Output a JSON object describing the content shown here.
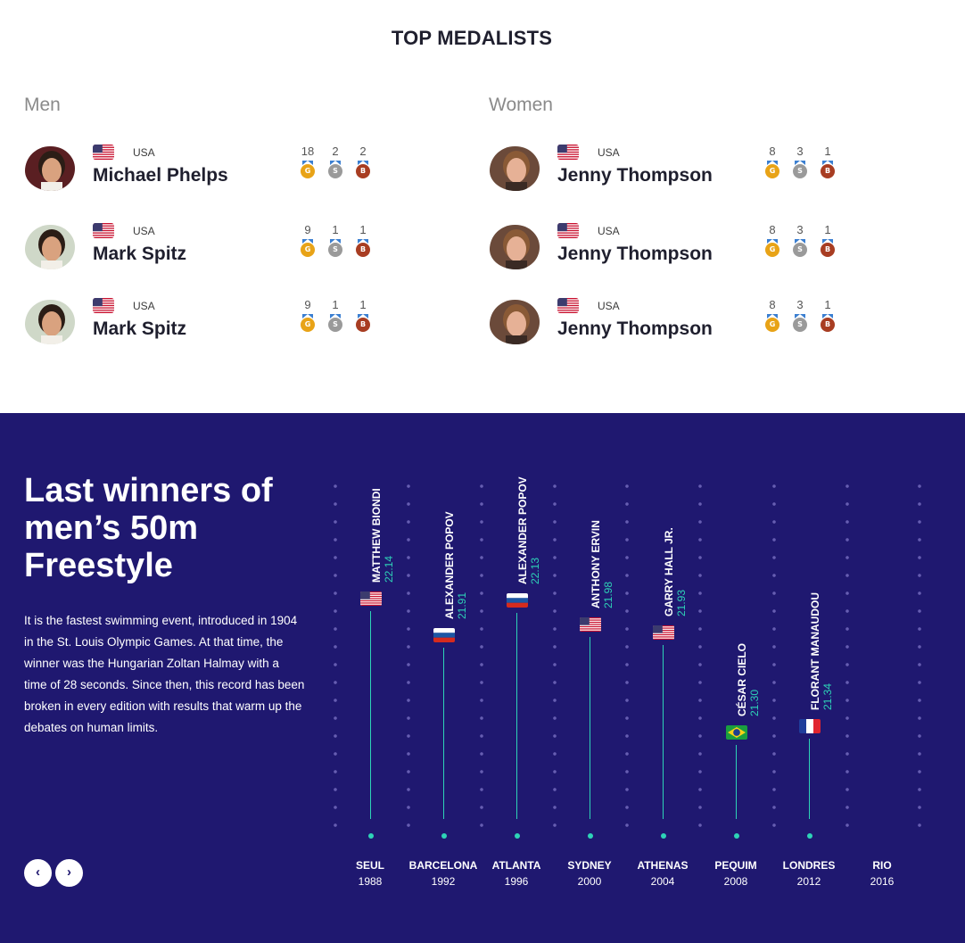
{
  "medalists": {
    "title": "TOP MEDALISTS",
    "men_label": "Men",
    "women_label": "Women",
    "men": [
      {
        "country": "USA",
        "name": "Michael Phelps",
        "gold": "18",
        "silver": "2",
        "bronze": "2"
      },
      {
        "country": "USA",
        "name": "Mark Spitz",
        "gold": "9",
        "silver": "1",
        "bronze": "1"
      },
      {
        "country": "USA",
        "name": "Mark Spitz",
        "gold": "9",
        "silver": "1",
        "bronze": "1"
      }
    ],
    "women": [
      {
        "country": "USA",
        "name": "Jenny Thompson",
        "gold": "8",
        "silver": "3",
        "bronze": "1"
      },
      {
        "country": "USA",
        "name": "Jenny Thompson",
        "gold": "8",
        "silver": "3",
        "bronze": "1"
      },
      {
        "country": "USA",
        "name": "Jenny Thompson",
        "gold": "8",
        "silver": "3",
        "bronze": "1"
      }
    ],
    "medal_letters": {
      "gold": "G",
      "silver": "S",
      "bronze": "B"
    },
    "medal_colors": {
      "gold": "#e8a317",
      "silver": "#9a9a9a",
      "bronze": "#a83d22",
      "ribbon": "#3b7fd1"
    }
  },
  "winners": {
    "title": "Last winners of men’s 50m Freestyle",
    "description": "It is the fastest swimming event, introduced in 1904 in the St. Louis Olympic Games. At that time, the winner was the Hungarian Zoltan Halmay with a time of 28 seconds. Since then, this record has been broken in every edition with results that warm up the debates on human limits.",
    "prev_icon": "chevron-left-icon",
    "next_icon": "chevron-right-icon",
    "accent": "#2ed3b7",
    "background": "#1f1870",
    "editions": [
      {
        "city": "SEUL",
        "year": "1988",
        "athlete": "MATTHEW BIONDI",
        "time": "22.14",
        "flag": "usa"
      },
      {
        "city": "BARCELONA",
        "year": "1992",
        "athlete": "ALEXANDER  POPOV",
        "time": "21.91",
        "flag": "russia"
      },
      {
        "city": "ATLANTA",
        "year": "1996",
        "athlete": "ALEXANDER  POPOV",
        "time": "22.13",
        "flag": "russia"
      },
      {
        "city": "SYDNEY",
        "year": "2000",
        "athlete": "ANTHONY ERVIN",
        "time": "21.98",
        "flag": "usa"
      },
      {
        "city": "ATHENAS",
        "year": "2004",
        "athlete": "GARRY HALL JR.",
        "time": "21.93",
        "flag": "usa"
      },
      {
        "city": "PEQUIM",
        "year": "2008",
        "athlete": "CÉSAR CIELO",
        "time": "21.30",
        "flag": "brazil"
      },
      {
        "city": "LONDRES",
        "year": "2012",
        "athlete": "FLORANT MANAUDOU",
        "time": "21.34",
        "flag": "france"
      },
      {
        "city": "RIO",
        "year": "2016",
        "athlete": "",
        "time": "",
        "flag": ""
      }
    ]
  }
}
